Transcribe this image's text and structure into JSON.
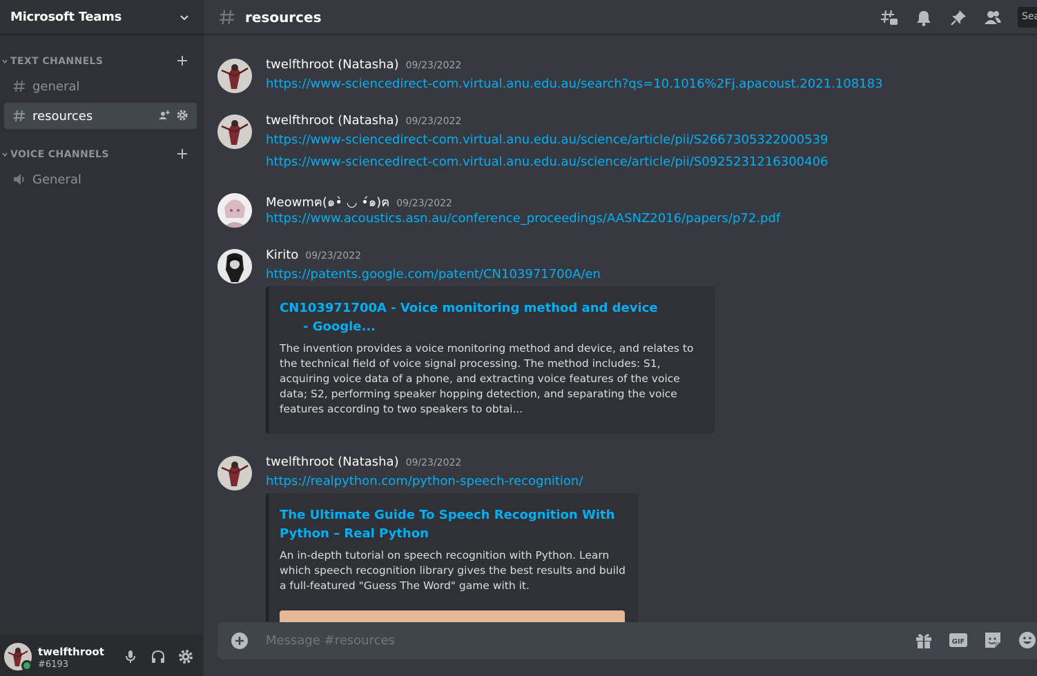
{
  "server": {
    "name": "Microsoft Teams"
  },
  "sidebar": {
    "categories": [
      {
        "label": "TEXT CHANNELS"
      },
      {
        "label": "VOICE CHANNELS"
      }
    ],
    "text_channels": [
      {
        "label": "general",
        "active": false
      },
      {
        "label": "resources",
        "active": true
      }
    ],
    "voice_channels": [
      {
        "label": "General"
      }
    ]
  },
  "user": {
    "name": "twelfthroot",
    "tag": "#6193",
    "status": "online"
  },
  "channel": {
    "name": "resources",
    "search_placeholder": "Search"
  },
  "messages": [
    {
      "author": "twelfthroot (Natasha)",
      "date": "09/23/2022",
      "links": [
        "https://www-sciencedirect-com.virtual.anu.edu.au/search?qs=10.1016%2Fj.apacoust.2021.108183"
      ]
    },
    {
      "author": "twelfthroot (Natasha)",
      "date": "09/23/2022",
      "links": [
        "https://www-sciencedirect-com.virtual.anu.edu.au/science/article/pii/S2667305322000539",
        "https://www-sciencedirect-com.virtual.anu.edu.au/science/article/pii/S0925231216300406"
      ]
    },
    {
      "author": "Meowmฅ(๑•̀ ◡ •́๑)ฅ",
      "date": "09/23/2022",
      "links": [
        "https://www.acoustics.asn.au/conference_proceedings/AASNZ2016/papers/p72.pdf"
      ]
    },
    {
      "author": "Kirito",
      "date": "09/23/2022",
      "links": [
        "https://patents.google.com/patent/CN103971700A/en"
      ],
      "embed": {
        "title_line1": "CN103971700A - Voice monitoring method and device",
        "title_line2": "- Google...",
        "description": "The invention provides a voice monitoring method and device, and relates to the technical field of voice signal processing. The method includes: S1, acquiring voice data of a phone, and extracting voice features of the voice data; S2, performing speaker hopping detection, and separating the voice features according to two speakers to obtai..."
      }
    },
    {
      "author": "twelfthroot (Natasha)",
      "date": "09/23/2022",
      "links": [
        "https://realpython.com/python-speech-recognition/"
      ],
      "embed": {
        "title": "The Ultimate Guide To Speech Recognition With Python – Real Python",
        "description": "An in-depth tutorial on speech recognition with Python. Learn which speech recognition library gives the best results and build a full-featured \"Guess The Word\" game with it."
      }
    }
  ],
  "composer": {
    "placeholder": "Message #resources",
    "gif_label": "GIF"
  },
  "colors": {
    "link": "#00aff4",
    "online": "#3ba55d",
    "background": "#36393f",
    "sidebar": "#2f3136"
  },
  "icons": [
    "chevron-down-icon",
    "plus-icon",
    "hash-icon",
    "add-member-icon",
    "gear-icon",
    "speaker-icon",
    "microphone-icon",
    "headphones-icon",
    "threads-icon",
    "bell-icon",
    "pin-icon",
    "members-icon",
    "add-circle-icon",
    "gift-icon",
    "gif-icon",
    "sticker-icon",
    "emoji-icon"
  ]
}
